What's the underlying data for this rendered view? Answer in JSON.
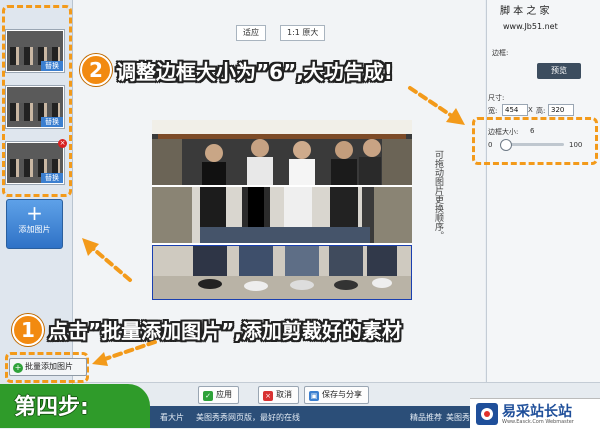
{
  "watermark": {
    "site": "脚 本 之 家",
    "url": "www.Jb51.net"
  },
  "left_panel": {
    "thumb_swap_label": "替换",
    "thumb_delete_glyph": "×",
    "add_image_label": "添加图片",
    "add_image_glyph": "+",
    "batch_add_label": "批量添加图片",
    "batch_add_glyph": "+"
  },
  "toolbar_top": {
    "fit_label": "适应",
    "original_label": "1:1 原大"
  },
  "right_panel": {
    "section_top": "边框:",
    "size_label": "尺寸:",
    "width_label": "宽:",
    "width_value": "454",
    "times_sign": "X",
    "height_label": "高:",
    "height_value": "320",
    "border_size_label": "边框大小:",
    "border_size_value": "6",
    "slider_min": "0",
    "slider_max": "100",
    "slider_fraction": 0.06,
    "preview_label": "预览"
  },
  "bottom_bar": {
    "apply_label": "应用",
    "cancel_label": "取消",
    "save_share_label": "保存与分享"
  },
  "status_bar": {
    "left_text": "看大片",
    "center_text": "美图秀秀网页版，最好的在线",
    "recommend_text": "精品推荐",
    "right_text": "美图秀秀"
  },
  "annotations": {
    "step2_number": "2",
    "step2_text": "调整边框大小为”6”,大功告成!",
    "step1_number": "1",
    "step1_text": "点击”批量添加图片”,添加剪裁好的素材",
    "step4_text": "第四步:",
    "handnote": "可拖动图片更换顺序。"
  },
  "logo": {
    "name": "易采站长站",
    "sub": "Www.Easck.Com Webmaster"
  },
  "colors": {
    "accent_orange": "#f39a1a",
    "step_green": "#2f9b2a",
    "ui_blue": "#3b7fd0"
  }
}
